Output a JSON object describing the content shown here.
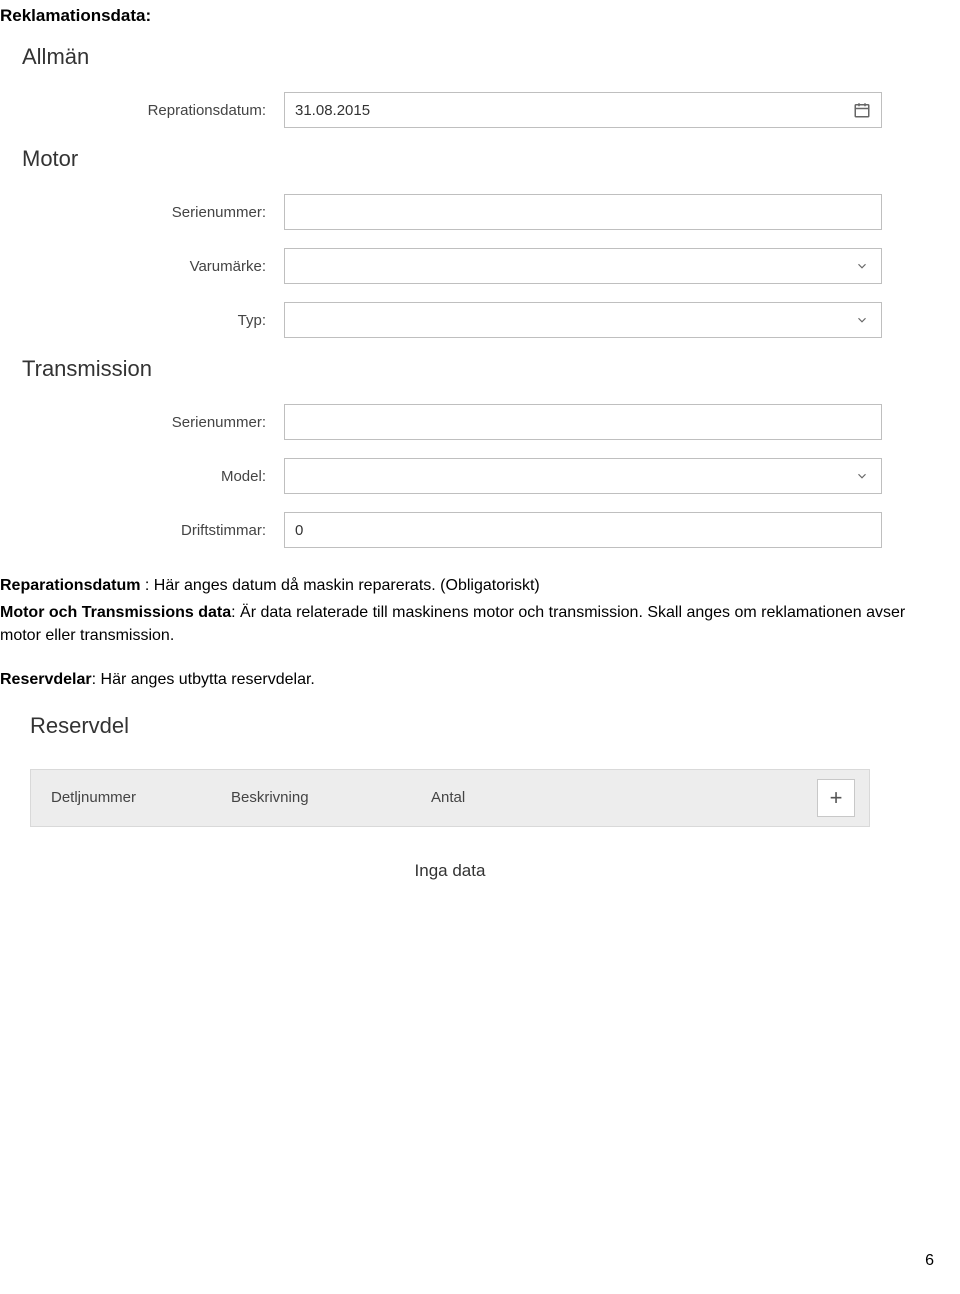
{
  "doc_title": "Reklamationsdata:",
  "sections": {
    "general_head": "Allmän",
    "motor_head": "Motor",
    "transmission_head": "Transmission",
    "reservdel_head": "Reservdel"
  },
  "fields": {
    "repair_date_label": "Reprationsdatum:",
    "repair_date_value": "31.08.2015",
    "motor_serial_label": "Serienummer:",
    "motor_serial_value": "",
    "motor_brand_label": "Varumärke:",
    "motor_brand_value": "",
    "motor_type_label": "Typ:",
    "motor_type_value": "",
    "trans_serial_label": "Serienummer:",
    "trans_serial_value": "",
    "trans_model_label": "Model:",
    "trans_model_value": "",
    "trans_hours_label": "Driftstimmar:",
    "trans_hours_value": "0"
  },
  "body_text": {
    "line1_label": "Reparationsdatum",
    "line1_rest": " : Här anges datum då maskin reparerats. (Obligatoriskt)",
    "line2_label": "Motor och Transmissions data",
    "line2_rest": ": Är data relaterade till maskinens motor och transmission. Skall anges om reklamationen avser motor eller transmission.",
    "line3_label": "Reservdelar",
    "line3_rest": ": Här anges utbytta reservdelar."
  },
  "table": {
    "col_detail": "Detljnummer",
    "col_desc": "Beskrivning",
    "col_qty": "Antal",
    "no_data": "Inga data"
  },
  "page_number": "6"
}
